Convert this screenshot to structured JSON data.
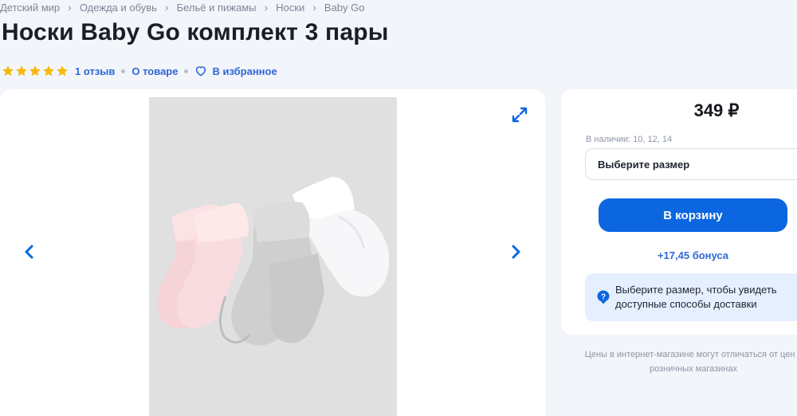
{
  "breadcrumb": [
    "Детский мир",
    "Одежда и обувь",
    "Бельё и пижамы",
    "Носки",
    "Baby Go"
  ],
  "product": {
    "title": "Носки Baby Go комплект 3 пары",
    "rating": 5,
    "reviews_label": "1 отзыв",
    "about_label": "О товаре",
    "favorite_label": "В избранное"
  },
  "gallery": {
    "prev_icon": "chevron-left-icon",
    "next_icon": "chevron-right-icon",
    "expand_icon": "expand-icon"
  },
  "buybox": {
    "price": "349 ₽",
    "availability": "В наличии: 10, 12, 14",
    "size_placeholder": "Выберите размер",
    "cart_label": "В корзину",
    "bonus": "+17,45 бонуса",
    "delivery_info": "Выберите размер, чтобы увидеть доступные способы доставки"
  },
  "price_note": "Цены в интернет-магазине могут отличаться от цен в розничных магазинах",
  "colors": {
    "accent": "#0b66e0",
    "link": "#2f67d8",
    "star": "#f5b90f",
    "page_bg": "#f2f5fa",
    "info_bg": "#e6efff"
  }
}
